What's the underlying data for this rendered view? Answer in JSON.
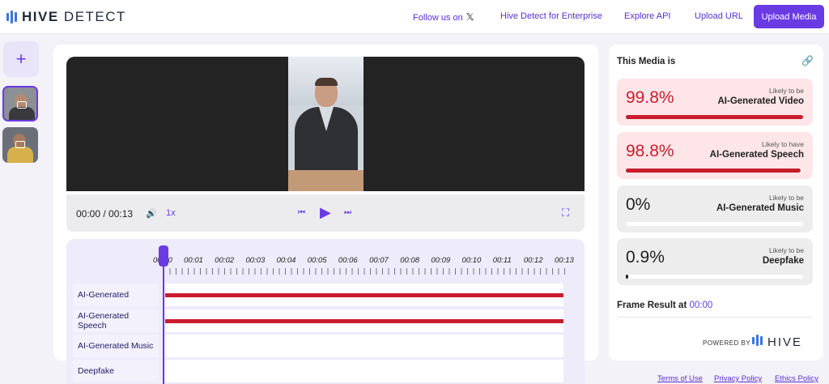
{
  "header": {
    "brand_bold": "HIVE",
    "brand_light": "DETECT",
    "nav": {
      "follow": "Follow us on",
      "x_glyph": "𝕏",
      "enterprise": "Hive Detect for Enterprise",
      "api": "Explore API",
      "upload_url": "Upload URL",
      "upload_media": "Upload Media"
    }
  },
  "sidebar": {
    "add_glyph": "+",
    "thumbnails": [
      "video-thumbnail",
      "video-thumbnail"
    ]
  },
  "player": {
    "time": "00:00 / 00:13",
    "speaker_glyph": "🔊",
    "speed": "1x",
    "prev_glyph": "⏮",
    "play_glyph": "▶",
    "next_glyph": "⏭",
    "fullscreen_glyph": "⛶"
  },
  "timeline": {
    "ticks": [
      "00:00",
      "00:01",
      "00:02",
      "00:03",
      "00:04",
      "00:05",
      "00:06",
      "00:07",
      "00:08",
      "00:09",
      "00:10",
      "00:11",
      "00:12",
      "00:13"
    ],
    "tracks": [
      {
        "label": "AI-Generated",
        "fill": 1.0
      },
      {
        "label": "AI-Generated Speech",
        "fill": 1.0
      },
      {
        "label": "AI-Generated Music",
        "fill": 0
      },
      {
        "label": "Deepfake",
        "fill": 0
      }
    ]
  },
  "results": {
    "title": "This Media is",
    "link_glyph": "🔗",
    "cards": [
      {
        "percent": "99.8%",
        "sub": "Likely to be",
        "label": "AI-Generated Video",
        "fill": 0.998,
        "style": "red"
      },
      {
        "percent": "98.8%",
        "sub": "Likely to have",
        "label": "AI-Generated Speech",
        "fill": 0.988,
        "style": "red"
      },
      {
        "percent": "0%",
        "sub": "Likely to be",
        "label": "AI-Generated Music",
        "fill": 0.0,
        "style": "grey"
      },
      {
        "percent": "0.9%",
        "sub": "Likely to be",
        "label": "Deepfake",
        "fill": 0.009,
        "style": "grey"
      }
    ],
    "frame_result_label": "Frame Result at",
    "frame_result_time": "00:00",
    "powered_by": "POWERED BY",
    "powered_brand": "HIVE"
  },
  "footer": {
    "terms": "Terms of Use",
    "privacy": "Privacy Policy",
    "ethics": "Ethics Policy"
  },
  "colors": {
    "accent": "#6a3be4",
    "danger": "#c81d2d",
    "brand_blue": "#3a78d8"
  }
}
